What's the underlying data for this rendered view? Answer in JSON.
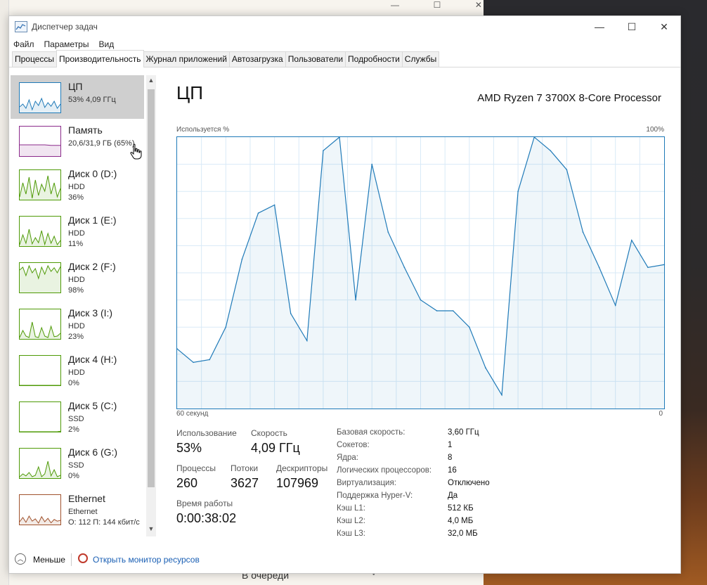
{
  "background": {
    "queue_text": "В очереди"
  },
  "window": {
    "title": "Диспетчер задач",
    "controls": [
      "—",
      "☐",
      "✕"
    ]
  },
  "menu": [
    "Файл",
    "Параметры",
    "Вид"
  ],
  "tabs": [
    "Процессы",
    "Производительность",
    "Журнал приложений",
    "Автозагрузка",
    "Пользователи",
    "Подробности",
    "Службы"
  ],
  "active_tab": "Производительность",
  "sidebar": [
    {
      "name": "ЦП",
      "line1": "53% 4,09 ГГц",
      "line2": "",
      "color": "#1f7ab8"
    },
    {
      "name": "Память",
      "line1": "20,6/31,9 ГБ (65%)",
      "line2": "",
      "color": "#8b2a8b"
    },
    {
      "name": "Диск 0 (D:)",
      "line1": "HDD",
      "line2": "36%",
      "color": "#4e9a06"
    },
    {
      "name": "Диск 1 (E:)",
      "line1": "HDD",
      "line2": "11%",
      "color": "#4e9a06"
    },
    {
      "name": "Диск 2 (F:)",
      "line1": "HDD",
      "line2": "98%",
      "color": "#4e9a06"
    },
    {
      "name": "Диск 3 (I:)",
      "line1": "HDD",
      "line2": "23%",
      "color": "#4e9a06"
    },
    {
      "name": "Диск 4 (H:)",
      "line1": "HDD",
      "line2": "0%",
      "color": "#4e9a06"
    },
    {
      "name": "Диск 5 (C:)",
      "line1": "SSD",
      "line2": "2%",
      "color": "#4e9a06"
    },
    {
      "name": "Диск 6 (G:)",
      "line1": "SSD",
      "line2": "0%",
      "color": "#4e9a06"
    },
    {
      "name": "Ethernet",
      "line1": "Ethernet",
      "line2": "О: 112  П: 144 кбит/с",
      "color": "#a0522d"
    }
  ],
  "cpu": {
    "title": "ЦП",
    "model": "AMD Ryzen 7 3700X 8-Core Processor",
    "axis_label": "Используется %",
    "axis_max": "100%",
    "time_label": "60 секунд",
    "time_end": "0",
    "stats": {
      "usage_label": "Использование",
      "usage_value": "53%",
      "speed_label": "Скорость",
      "speed_value": "4,09 ГГц",
      "processes_label": "Процессы",
      "processes_value": "260",
      "threads_label": "Потоки",
      "threads_value": "3627",
      "handles_label": "Дескрипторы",
      "handles_value": "107969",
      "uptime_label": "Время работы",
      "uptime_value": "0:00:38:02"
    },
    "info": [
      {
        "label": "Базовая скорость:",
        "value": "3,60 ГГц"
      },
      {
        "label": "Сокетов:",
        "value": "1"
      },
      {
        "label": "Ядра:",
        "value": "8"
      },
      {
        "label": "Логических процессоров:",
        "value": "16"
      },
      {
        "label": "Виртуализация:",
        "value": "Отключено"
      },
      {
        "label": "Поддержка Hyper-V:",
        "value": "Да"
      },
      {
        "label": "Кэш L1:",
        "value": "512 КБ"
      },
      {
        "label": "Кэш L2:",
        "value": "4,0 МБ"
      },
      {
        "label": "Кэш L3:",
        "value": "32,0 МБ"
      }
    ]
  },
  "chart_data": {
    "type": "area",
    "xlabel": "",
    "ylabel": "Используется %",
    "ylim": [
      0,
      100
    ],
    "x": [
      60,
      58,
      56,
      54,
      52,
      50,
      48,
      46,
      44,
      42,
      40,
      38,
      36,
      34,
      32,
      30,
      28,
      26,
      24,
      22,
      20,
      18,
      16,
      14,
      12,
      10,
      8,
      6,
      4,
      2,
      0
    ],
    "values": [
      22,
      17,
      18,
      30,
      55,
      72,
      75,
      35,
      25,
      95,
      100,
      40,
      90,
      65,
      52,
      40,
      36,
      36,
      30,
      15,
      5,
      80,
      100,
      95,
      88,
      65,
      52,
      38,
      62,
      52,
      53
    ]
  },
  "bottom": {
    "less": "Меньше",
    "monitor": "Открыть монитор ресурсов"
  }
}
